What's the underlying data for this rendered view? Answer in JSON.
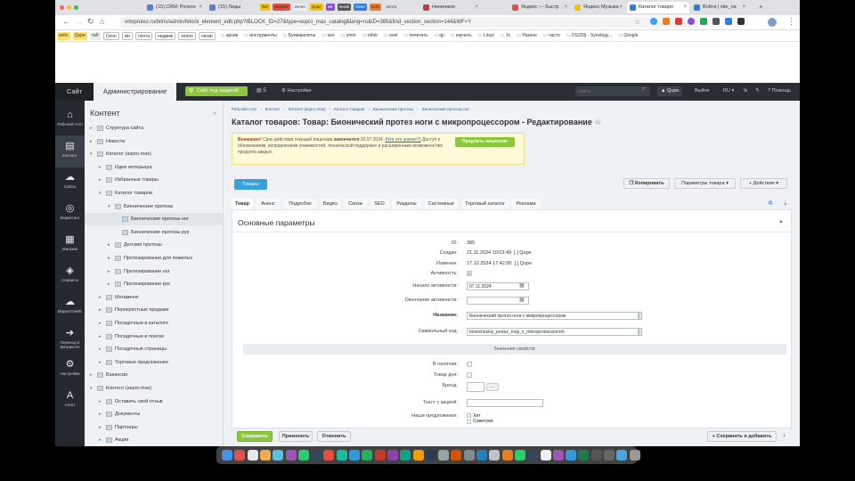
{
  "browser": {
    "tabs": [
      {
        "label": "(15) CRM: Регион",
        "color": "#5b7dd8"
      },
      {
        "label": "(15) Лиды",
        "color": "#5b7dd8"
      },
      {
        "label": "Начинаем",
        "color": "#c03b3b"
      },
      {
        "label": "Яндекс — быстр",
        "color": "#e74c3c"
      },
      {
        "label": "Яндекс Музыка",
        "color": "#f4c20d"
      },
      {
        "label": "Каталог товаро",
        "color": "#2f7de1"
      },
      {
        "label": "Войти | site_na",
        "color": "#2f7de1"
      }
    ],
    "mini_tabs": [
      "таб",
      "недвиж",
      "zenno",
      "Qupe",
      "wb",
      "nerab",
      "Ozon",
      "avito",
      "почта"
    ],
    "url": "ortoprotez.ru/bitrix/admin/iblock_element_edit.php?IBLOCK_ID=27&type=aspro_max_catalog&lang=ru&ID=385&find_section_section=144&WF=Y",
    "bookmarks": [
      "avito",
      "Qupe",
      "таб",
      "Ozon",
      "wb",
      "почта",
      "недвиж",
      "zenno",
      "nerab"
    ],
    "bookmark_folders": [
      "архив",
      "инструменты",
      "Букмарклеты",
      "seo",
      "smm",
      "other",
      "exel",
      "почитать",
      "qp",
      "изучить",
      "Linux",
      "1с",
      "Разное",
      "часто",
      "DS220j - Synology...",
      "Google"
    ]
  },
  "adminbar": {
    "site_tab": "Сайт",
    "admin_tab": "Администрирование",
    "protected_badge": "Сайт под защитой",
    "notif_count": "5",
    "settings": "Настройки",
    "search_placeholder": "поиск...",
    "user": "Qupe",
    "logout": "Выйти",
    "lang": "RU",
    "help": "Помощь"
  },
  "leftnav": [
    {
      "label": "Рабочий стол",
      "icon": "⌂"
    },
    {
      "label": "Контент",
      "icon": "▤"
    },
    {
      "label": "Сайты",
      "icon": "☁"
    },
    {
      "label": "Маркетинг",
      "icon": "◎"
    },
    {
      "label": "Магазин",
      "icon": "▦"
    },
    {
      "label": "Сервисы",
      "icon": "◈"
    },
    {
      "label": "Маркетплейс",
      "icon": "☁"
    },
    {
      "label": "Переход в Битрикс24",
      "icon": "➔"
    },
    {
      "label": "Настройки",
      "icon": "⚙"
    },
    {
      "label": "Агент",
      "icon": "A"
    }
  ],
  "menu": {
    "title": "Контент",
    "items": [
      {
        "label": "Структура сайта",
        "level": 1,
        "arrow": "▸",
        "sel": false
      },
      {
        "label": "Новости",
        "level": 1,
        "arrow": "▸",
        "sel": false
      },
      {
        "label": "Каталог (aspro.max)",
        "level": 1,
        "arrow": "▾",
        "sel": false
      },
      {
        "label": "Идеи интерьера",
        "level": 2,
        "arrow": "▸",
        "sel": false
      },
      {
        "label": "Избранные товары",
        "level": 2,
        "arrow": "▸",
        "sel": false
      },
      {
        "label": "Каталог товаров",
        "level": 2,
        "arrow": "▾",
        "sel": false
      },
      {
        "label": "Бионические протезы",
        "level": 3,
        "arrow": "▾",
        "sel": false
      },
      {
        "label": "Бионические протезы ног",
        "level": 4,
        "arrow": "",
        "sel": true
      },
      {
        "label": "Бионические протезы рук",
        "level": 4,
        "arrow": "",
        "sel": false
      },
      {
        "label": "Детские протезы",
        "level": 3,
        "arrow": "▸",
        "sel": false
      },
      {
        "label": "Протезирование для пожилых",
        "level": 3,
        "arrow": "▸",
        "sel": false
      },
      {
        "label": "Протезирование ног",
        "level": 3,
        "arrow": "▸",
        "sel": false
      },
      {
        "label": "Протезирование рук",
        "level": 3,
        "arrow": "▸",
        "sel": false
      },
      {
        "label": "Мегаменю",
        "level": 2,
        "arrow": "▸",
        "sel": false
      },
      {
        "label": "Перекрестные продажи",
        "level": 2,
        "arrow": "▸",
        "sel": false
      },
      {
        "label": "Посадочные в каталоге",
        "level": 2,
        "arrow": "▸",
        "sel": false
      },
      {
        "label": "Посадочные в поиске",
        "level": 2,
        "arrow": "▸",
        "sel": false
      },
      {
        "label": "Посадочные страницы",
        "level": 2,
        "arrow": "▸",
        "sel": false
      },
      {
        "label": "Торговые предложения",
        "level": 2,
        "arrow": "▸",
        "sel": false
      },
      {
        "label": "Вакансии",
        "level": 1,
        "arrow": "▸",
        "sel": false
      },
      {
        "label": "Контент (aspro.max)",
        "level": 1,
        "arrow": "▾",
        "sel": false
      },
      {
        "label": "Оставить свой отзыв",
        "level": 2,
        "arrow": "▸",
        "sel": false
      },
      {
        "label": "Документы",
        "level": 2,
        "arrow": "▸",
        "sel": false
      },
      {
        "label": "Партнеры",
        "level": 2,
        "arrow": "▸",
        "sel": false
      },
      {
        "label": "Акции",
        "level": 2,
        "arrow": "▸",
        "sel": false
      }
    ]
  },
  "breadcrumb": [
    "Рабочий стол",
    "Контент",
    "Каталог (aspro.max)",
    "Каталог товаров",
    "Бионические протезы",
    "Бионические протезы ног"
  ],
  "page_title": "Каталог товаров: Товар: Бионический протез ноги с микропроцессором - Редактирование",
  "notice": {
    "prefix": "Внимание!",
    "text1": "Срок действия текущей лицензии",
    "text_bold": "закончился",
    "date": "28.07.2024.",
    "link": "(Что это значит?)",
    "text2": "Доступ к обновлениям, исправлениям уязвимостей, технической поддержке и расширенным возможностям продукта закрыт.",
    "button": "Продлить лицензию"
  },
  "toolbar": {
    "products_btn": "Товары",
    "copy": "Копировать",
    "params": "Параметры товара",
    "actions": "Действия"
  },
  "tabs": [
    "Товар",
    "Анонс",
    "Подробно",
    "Видео",
    "Связи",
    "SEO",
    "Разделы",
    "Системные",
    "Торговый каталог",
    "Реклама"
  ],
  "section_title": "Основные параметры",
  "fields": {
    "id_label": "ID:",
    "id_value": "385",
    "created_label": "Создан:",
    "created_value": "21.11.2024 10:03:49",
    "created_user": "Qupe",
    "changed_label": "Изменен:",
    "changed_value": "17.12.2024 17:42:00",
    "changed_user": "Qupe",
    "active_label": "Активность:",
    "active_from_label": "Начало активности:",
    "active_from_value": "07.11.2024",
    "active_to_label": "Окончание активности:",
    "name_label": "Название:",
    "name_value": "Бионический протез ноги с микропроцессором",
    "code_label": "Символьный код:",
    "code_value": "bionicheskiy_protez_nogi_s_mikroprotsessorom",
    "props_header": "Значения свойств:",
    "instock_label": "В наличии:",
    "daydeal_label": "Товар дня:",
    "brand_label": "Бренд:",
    "brand_btn": "...",
    "sale_text_label": "Текст с акцией:",
    "offers_label": "Наши предложения:",
    "offer1": "Хит",
    "offer2": "Советуем"
  },
  "footer": {
    "save": "Сохранить",
    "apply": "Применить",
    "cancel": "Отменить",
    "save_add": "Сохранить и добавить"
  }
}
